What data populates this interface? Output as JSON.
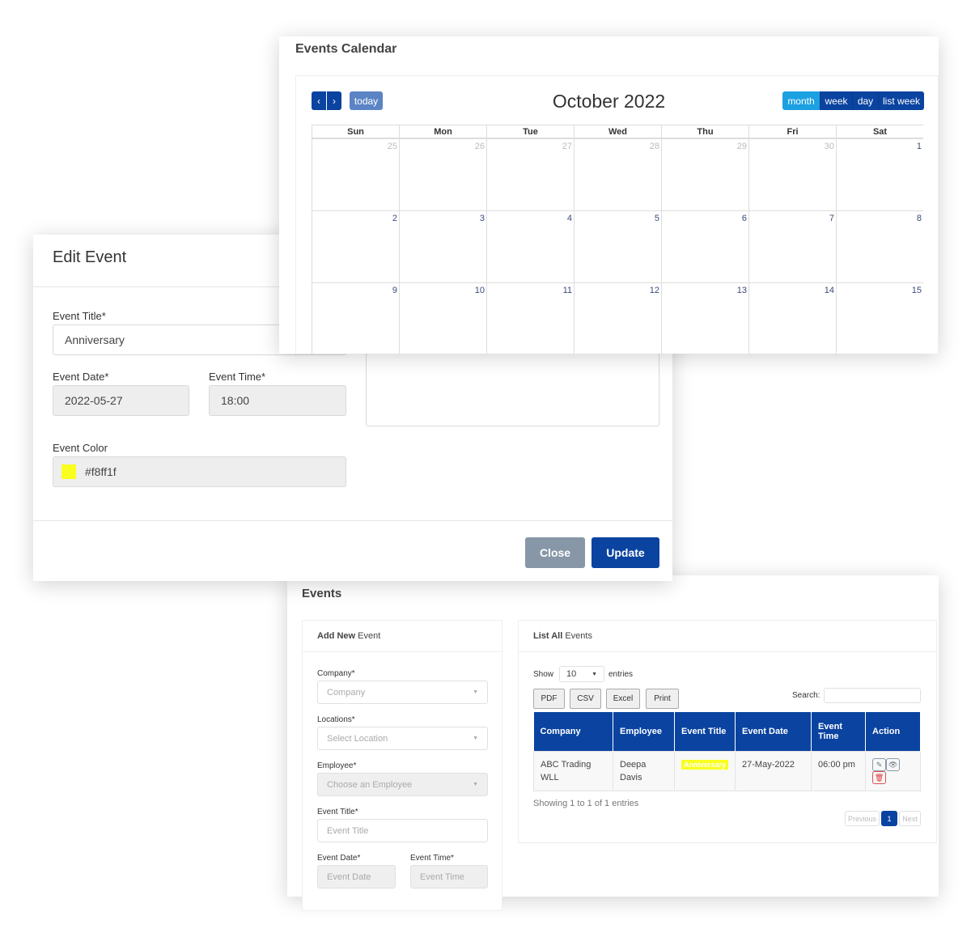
{
  "edit_event": {
    "title": "Edit Event",
    "event_title_label": "Event Title*",
    "event_title_value": "Anniversary",
    "event_date_label": "Event Date*",
    "event_date_value": "2022-05-27",
    "event_time_label": "Event Time*",
    "event_time_value": "18:00",
    "event_color_label": "Event Color",
    "event_color_value": "#f8ff1f",
    "color_swatch": "#f8ff1f",
    "close_label": "Close",
    "update_label": "Update"
  },
  "calendar": {
    "title": "Events Calendar",
    "prev": "‹",
    "next": "›",
    "today": "today",
    "month_title": "October 2022",
    "views": [
      "month",
      "week",
      "day",
      "list week"
    ],
    "active_view": "month",
    "weekdays": [
      "Sun",
      "Mon",
      "Tue",
      "Wed",
      "Thu",
      "Fri",
      "Sat"
    ],
    "weeks": [
      [
        "25",
        "26",
        "27",
        "28",
        "29",
        "30",
        "1"
      ],
      [
        "2",
        "3",
        "4",
        "5",
        "6",
        "7",
        "8"
      ],
      [
        "9",
        "10",
        "11",
        "12",
        "13",
        "14",
        "15"
      ]
    ]
  },
  "events": {
    "title": "Events",
    "add_panel": {
      "title_bold": "Add New",
      "title_rest": " Event",
      "company_label": "Company*",
      "company_placeholder": "Company",
      "location_label": "Locations*",
      "location_placeholder": "Select Location",
      "employee_label": "Employee*",
      "employee_placeholder": "Choose an Employee",
      "event_title_label": "Event Title*",
      "event_title_placeholder": "Event Title",
      "event_date_label": "Event Date*",
      "event_date_placeholder": "Event Date",
      "event_time_label": "Event Time*",
      "event_time_placeholder": "Event Time"
    },
    "list_panel": {
      "title_bold": "List All",
      "title_rest": " Events",
      "show": "Show",
      "entries_value": "10",
      "entries": "entries",
      "buttons": [
        "PDF",
        "CSV",
        "Excel",
        "Print"
      ],
      "search_label": "Search:",
      "columns": [
        "Company",
        "Employee",
        "Event Title",
        "Event Date",
        "Event Time",
        "Action"
      ],
      "rows": [
        {
          "company": "ABC Trading WLL",
          "employee": "Deepa Davis",
          "event_title": "Anniversary",
          "event_date": "27-May-2022",
          "event_time": "06:00 pm"
        }
      ],
      "info": "Showing 1 to 1 of 1 entries",
      "previous": "Previous",
      "page": "1",
      "next": "Next"
    }
  }
}
